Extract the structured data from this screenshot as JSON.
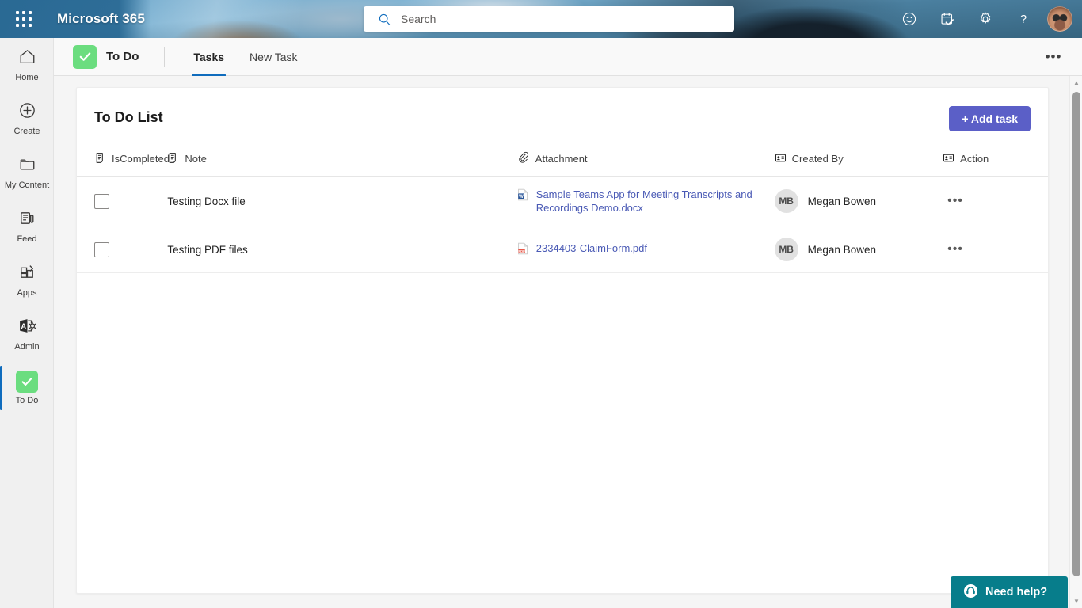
{
  "suite": {
    "brand": "Microsoft 365",
    "waffle_name": "app-launcher",
    "search": {
      "placeholder": "Search",
      "value": ""
    },
    "actions": [
      {
        "name": "feedback-icon",
        "label": "Feedback"
      },
      {
        "name": "calendar-check-icon",
        "label": "Tasks"
      },
      {
        "name": "gear-icon",
        "label": "Settings"
      },
      {
        "name": "help-icon",
        "label": "Help"
      }
    ],
    "avatar_label": "Account manager"
  },
  "rail": {
    "items": [
      {
        "label": "Home",
        "icon": "home-icon",
        "active": false
      },
      {
        "label": "Create",
        "icon": "plus-circle-icon",
        "active": false
      },
      {
        "label": "My Content",
        "icon": "folder-icon",
        "active": false
      },
      {
        "label": "Feed",
        "icon": "feed-icon",
        "active": false
      },
      {
        "label": "Apps",
        "icon": "apps-icon",
        "active": false
      },
      {
        "label": "Admin",
        "icon": "admin-icon",
        "active": false
      },
      {
        "label": "To Do",
        "icon": "todo-check-icon",
        "active": true
      }
    ]
  },
  "app_header": {
    "title": "To Do",
    "icon": "todo-check-icon",
    "tabs": [
      {
        "label": "Tasks",
        "active": true
      },
      {
        "label": "New Task",
        "active": false
      }
    ],
    "overflow_label": "•••"
  },
  "main": {
    "list_title": "To Do List",
    "add_task_label": "+ Add task",
    "columns": [
      {
        "label": "IsCompleted",
        "icon": "note-icon"
      },
      {
        "label": "Note",
        "icon": "note-icon"
      },
      {
        "label": "Attachment",
        "icon": "paperclip-icon"
      },
      {
        "label": "Created By",
        "icon": "person-card-icon"
      },
      {
        "label": "Action",
        "icon": "person-card-icon"
      }
    ],
    "rows": [
      {
        "is_completed": false,
        "note": "Testing Docx file",
        "attachment": "Sample Teams App for Meeting Transcripts and Recordings Demo.docx",
        "attachment_type": "word",
        "created_by": "Megan Bowen",
        "initials": "MB",
        "action_label": "•••"
      },
      {
        "is_completed": false,
        "note": "Testing PDF files",
        "attachment": "2334403-ClaimForm.pdf",
        "attachment_type": "pdf",
        "created_by": "Megan Bowen",
        "initials": "MB",
        "action_label": "•••"
      }
    ]
  },
  "need_help": {
    "label": "Need help?",
    "icon": "headset-icon"
  },
  "colors": {
    "suite_bar": "#2d6a96",
    "accent_blue": "#0f6cbd",
    "add_task_purple": "#5b5fc7",
    "todo_green": "#6bdd7f",
    "link_blue": "#4a5ab5",
    "need_help_teal": "#077d8b"
  }
}
